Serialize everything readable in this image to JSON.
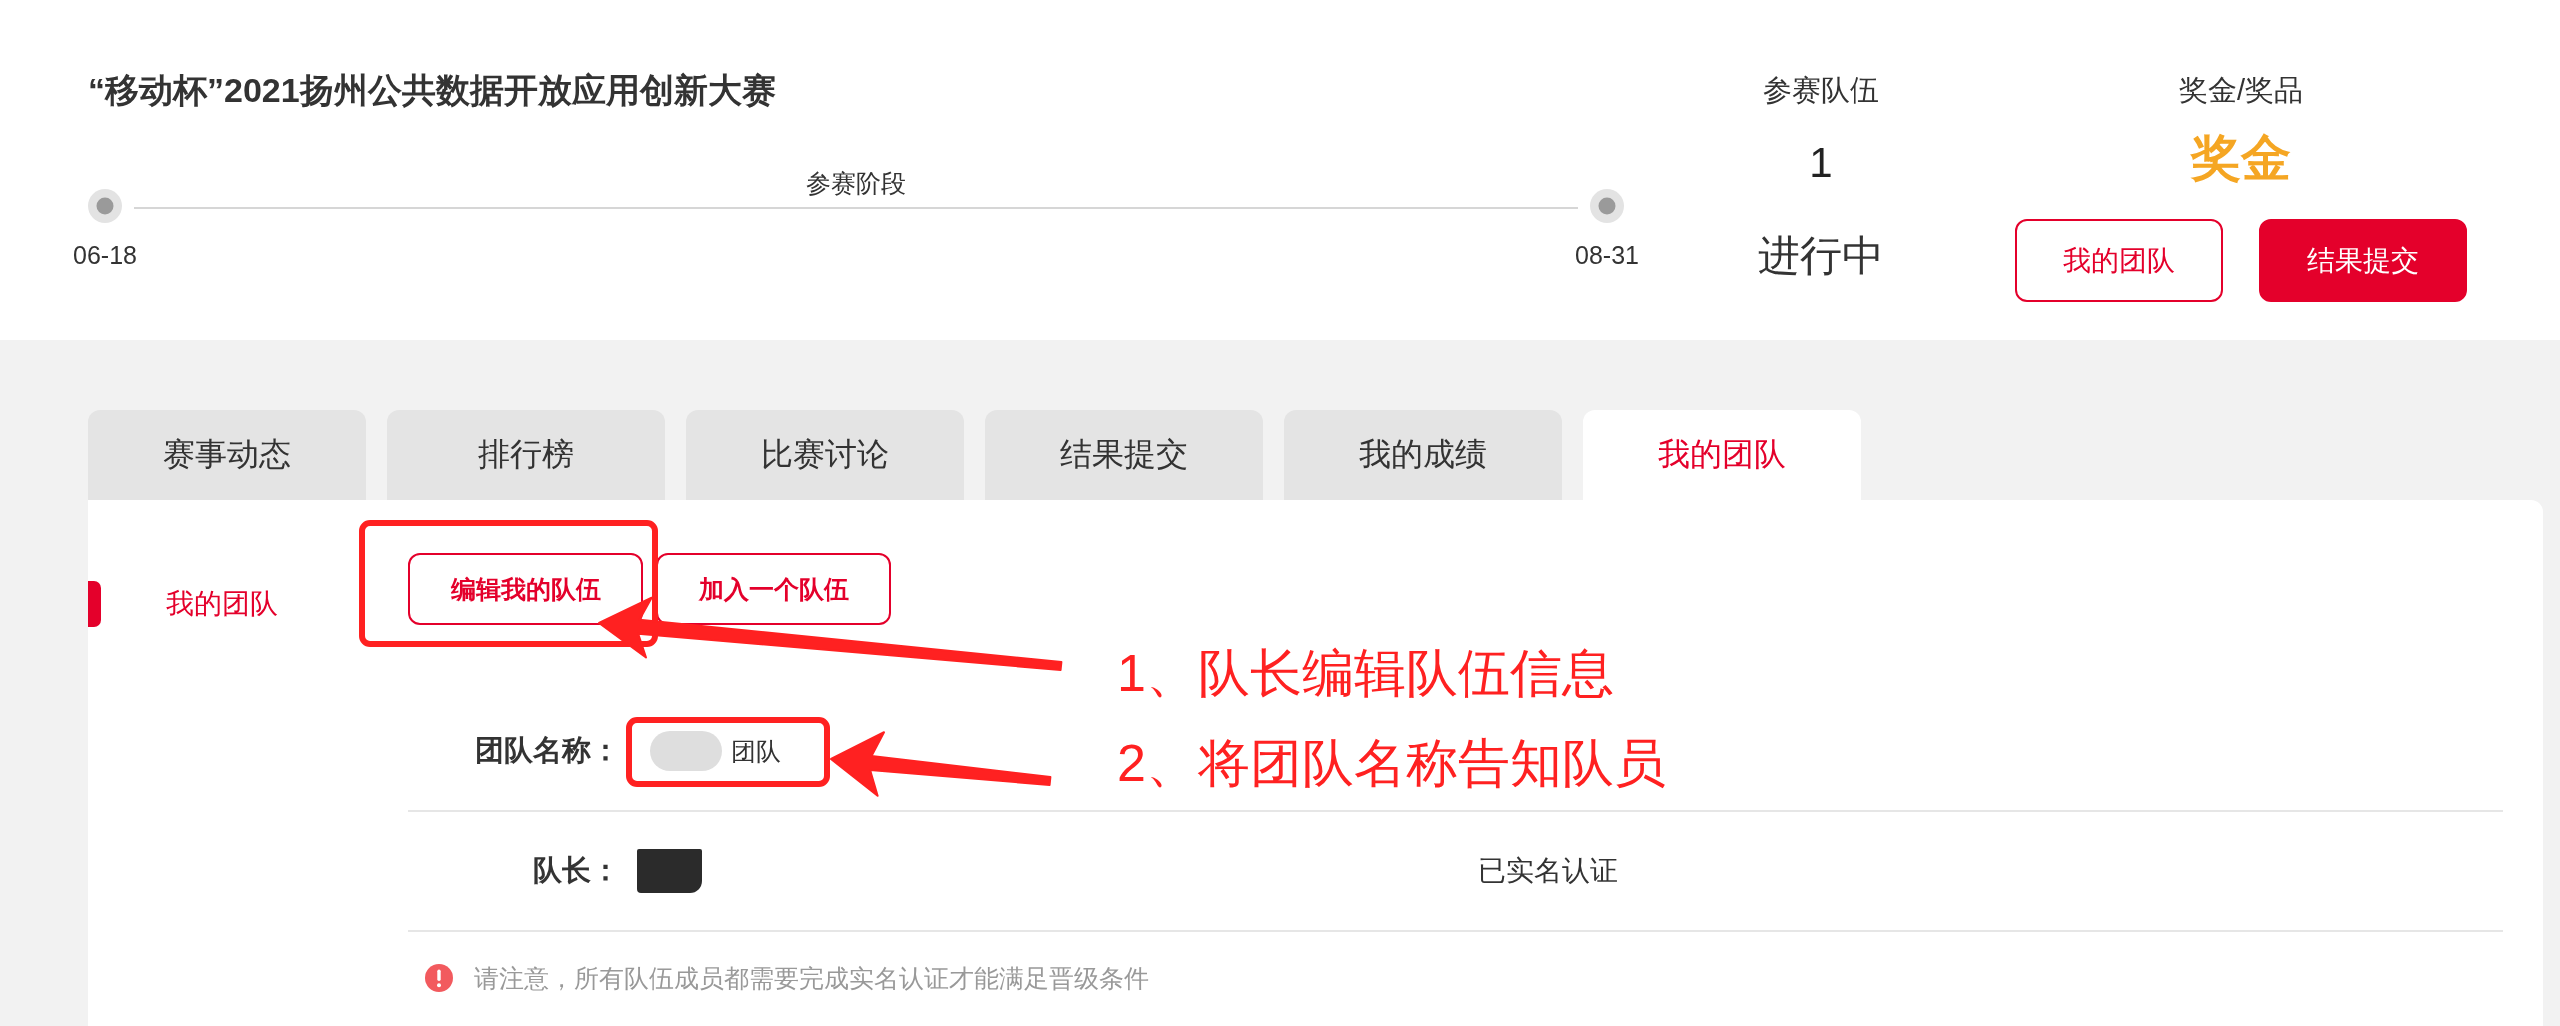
{
  "header": {
    "title": "“移动杯”2021扬州公共数据开放应用创新大赛",
    "timeline": {
      "phase": "参赛阶段",
      "start_date": "06-18",
      "end_date": "08-31"
    },
    "teams": {
      "label": "参赛队伍",
      "count": "1",
      "status": "进行中"
    },
    "prize": {
      "label": "奖金/奖品",
      "value": "奖金"
    },
    "buttons": [
      {
        "label": "我的团队",
        "kind": "outline"
      },
      {
        "label": "结果提交",
        "kind": "filled"
      }
    ]
  },
  "tabs": [
    {
      "label": "赛事动态",
      "selected": false
    },
    {
      "label": "排行榜",
      "selected": false
    },
    {
      "label": "比赛讨论",
      "selected": false
    },
    {
      "label": "结果提交",
      "selected": false
    },
    {
      "label": "我的成绩",
      "selected": false
    },
    {
      "label": "我的团队",
      "selected": true
    }
  ],
  "side_menu": {
    "items": [
      {
        "label": "我的团队",
        "selected": true
      }
    ]
  },
  "team_actions": [
    "编辑我的队伍",
    "加入一个队伍"
  ],
  "team_info": [
    {
      "kind": "blurred",
      "label": "团队名称：",
      "value": "团队"
    },
    {
      "kind": "masked",
      "label": "队长：",
      "status": "已实名认证"
    }
  ],
  "notice": "请注意，所有队伍成员都需要完成实名认证才能满足晋级条件",
  "annotations": [
    {
      "text": "1、队长编辑队伍信息"
    },
    {
      "text": "2、将团队名称告知队员"
    }
  ]
}
